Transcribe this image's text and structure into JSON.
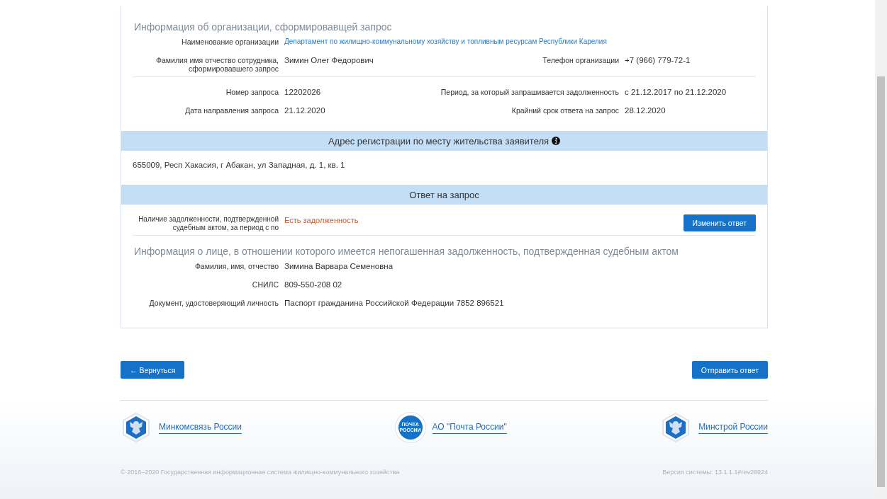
{
  "org_section": {
    "title": "Информация об организации, сформировавщей запрос",
    "rows": [
      {
        "pairs": [
          {
            "label": "Наименование организации",
            "value": "Департамент по жилищно-коммунальному хозяйству и топливным ресурсам Республики Карелия",
            "kind": "link"
          }
        ]
      },
      {
        "pairs": [
          {
            "label": "Фамилия имя отчество сотрудника, сформировавшего запрос",
            "value": "Зимин Олег Федорович"
          },
          {
            "label": "Телефон организации",
            "value": "+7 (966) 779-72-1"
          }
        ]
      }
    ],
    "request_rows": [
      {
        "pairs": [
          {
            "label": "Номер запроса",
            "value": "12202026"
          },
          {
            "label": "Период, за который запрашивается задолженность",
            "value": "с 21.12.2017 по 21.12.2020"
          }
        ]
      },
      {
        "pairs": [
          {
            "label": "Дата направления запроса",
            "value": "21.12.2020"
          },
          {
            "label": "Крайний срок ответа на запрос",
            "value": "28.12.2020"
          }
        ]
      }
    ]
  },
  "address_section": {
    "title": "Адрес регистрации по месту жительства заявителя",
    "address": "655009, Респ Хакасия, г Абакан, ул Западная, д. 1, кв. 1"
  },
  "answer_section": {
    "title": "Ответ на запрос",
    "debt_label": "Наличие задолженности, подтвержденной судебным актом, за период с по",
    "debt_value": "Есть задолженность",
    "change_button": "Изменить ответ",
    "person_title": "Информация о лице, в отношении которого имеется непогашенная задолженность, подтвержденная судебным актом",
    "person_rows": [
      {
        "label": "Фамилия, имя, отчество",
        "value": "Зимина Варвара Семеновна"
      },
      {
        "label": "СНИЛС",
        "value": "809-550-208 02"
      },
      {
        "label": "Документ, удостоверяющий личность",
        "value": "Паспорт гражданина Российской Федерации 7852 896521"
      }
    ]
  },
  "buttons": {
    "back": "Вернуться",
    "back_arrow": "←",
    "send": "Отправить ответ"
  },
  "footer": {
    "links": [
      {
        "label": "Минкомсвязь России",
        "kind": "emblem"
      },
      {
        "label": "АО \"Почта России\"",
        "kind": "post",
        "logo_text": "ПОЧТА РОССИИ"
      },
      {
        "label": "Минстрой России",
        "kind": "emblem"
      }
    ],
    "copyright": "© 2016–2020 Государственная информационная система жилищно-коммунального хозяйства",
    "version": "Версия системы: 13.1.1.1#rev28924"
  }
}
